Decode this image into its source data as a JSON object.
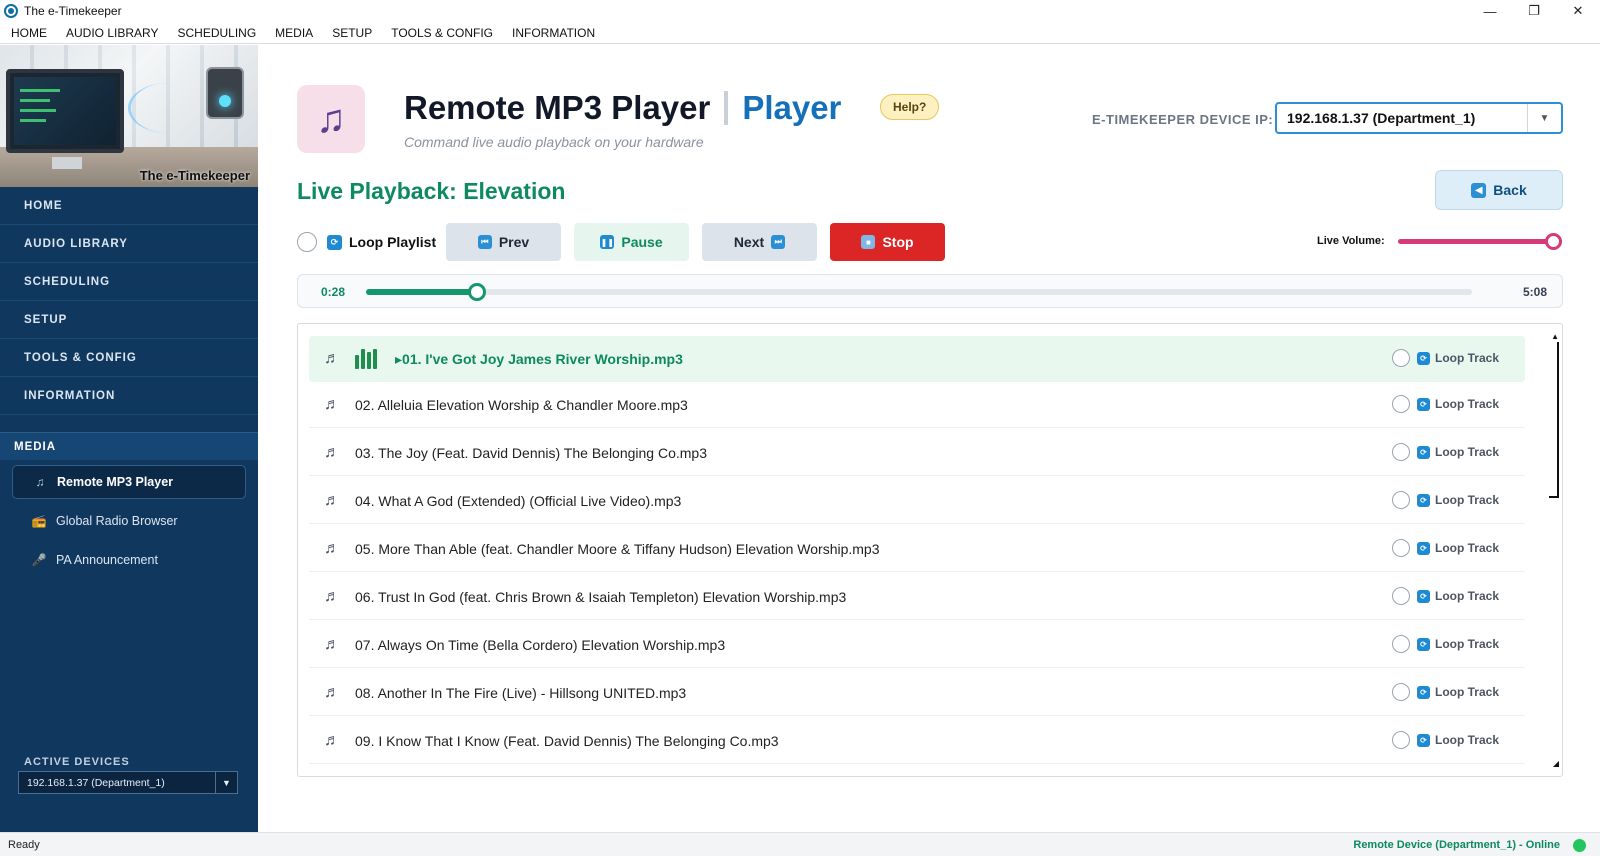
{
  "window": {
    "title": "The e-Timekeeper",
    "minimize": "—",
    "maximize": "❐",
    "close": "✕"
  },
  "menu": [
    "HOME",
    "AUDIO LIBRARY",
    "SCHEDULING",
    "MEDIA",
    "SETUP",
    "TOOLS & CONFIG",
    "INFORMATION"
  ],
  "sidebar": {
    "logo_caption": "The e-Timekeeper",
    "nav": [
      "HOME",
      "AUDIO LIBRARY",
      "SCHEDULING",
      "SETUP",
      "TOOLS & CONFIG",
      "INFORMATION"
    ],
    "section": "MEDIA",
    "sub_items": [
      {
        "label": "Remote MP3 Player",
        "icon": "music-note-icon",
        "active": true
      },
      {
        "label": "Global Radio Browser",
        "icon": "radio-icon",
        "active": false
      },
      {
        "label": "PA Announcement",
        "icon": "microphone-icon",
        "active": false
      }
    ],
    "active_devices_label": "ACTIVE DEVICES",
    "active_device": "192.168.1.37  (Department_1)"
  },
  "header": {
    "title": "Remote MP3 Player",
    "title_accent": "Player",
    "help": "Help?",
    "subtitle": "Command live audio playback on your hardware",
    "ip_label": "E-TIMEKEEPER DEVICE IP:",
    "ip_value": "192.168.1.37  (Department_1)"
  },
  "playback": {
    "title": "Live Playback: Elevation",
    "back_label": "Back",
    "loop_playlist": "Loop Playlist",
    "prev": "Prev",
    "pause": "Pause",
    "next": "Next",
    "stop": "Stop",
    "volume_label": "Live Volume:",
    "volume_fraction": 1.0,
    "time_current": "0:28",
    "time_total": "5:08",
    "progress_fraction": 0.1
  },
  "tracks": [
    {
      "name": "▸01. I've Got Joy  James River Worship.mp3",
      "playing": true
    },
    {
      "name": "02. Alleluia  Elevation Worship & Chandler Moore.mp3",
      "playing": false
    },
    {
      "name": "03. The Joy (Feat. David Dennis)  The Belonging Co.mp3",
      "playing": false
    },
    {
      "name": "04. What A God (Extended) (Official Live Video).mp3",
      "playing": false
    },
    {
      "name": "05. More Than Able (feat. Chandler Moore & Tiffany Hudson)  Elevation Worship.mp3",
      "playing": false
    },
    {
      "name": "06. Trust In God (feat. Chris Brown & Isaiah Templeton)  Elevation Worship.mp3",
      "playing": false
    },
    {
      "name": "07. Always On Time (Bella Cordero)  Elevation Worship.mp3",
      "playing": false
    },
    {
      "name": "08. Another In The Fire (Live) - Hillsong UNITED.mp3",
      "playing": false
    },
    {
      "name": "09. I Know That I Know (Feat. David Dennis)  The Belonging Co.mp3",
      "playing": false
    }
  ],
  "loop_track_label": "Loop Track",
  "status": {
    "left": "Ready",
    "right": "Remote Device (Department_1) - Online",
    "online_color": "#22c55e"
  }
}
